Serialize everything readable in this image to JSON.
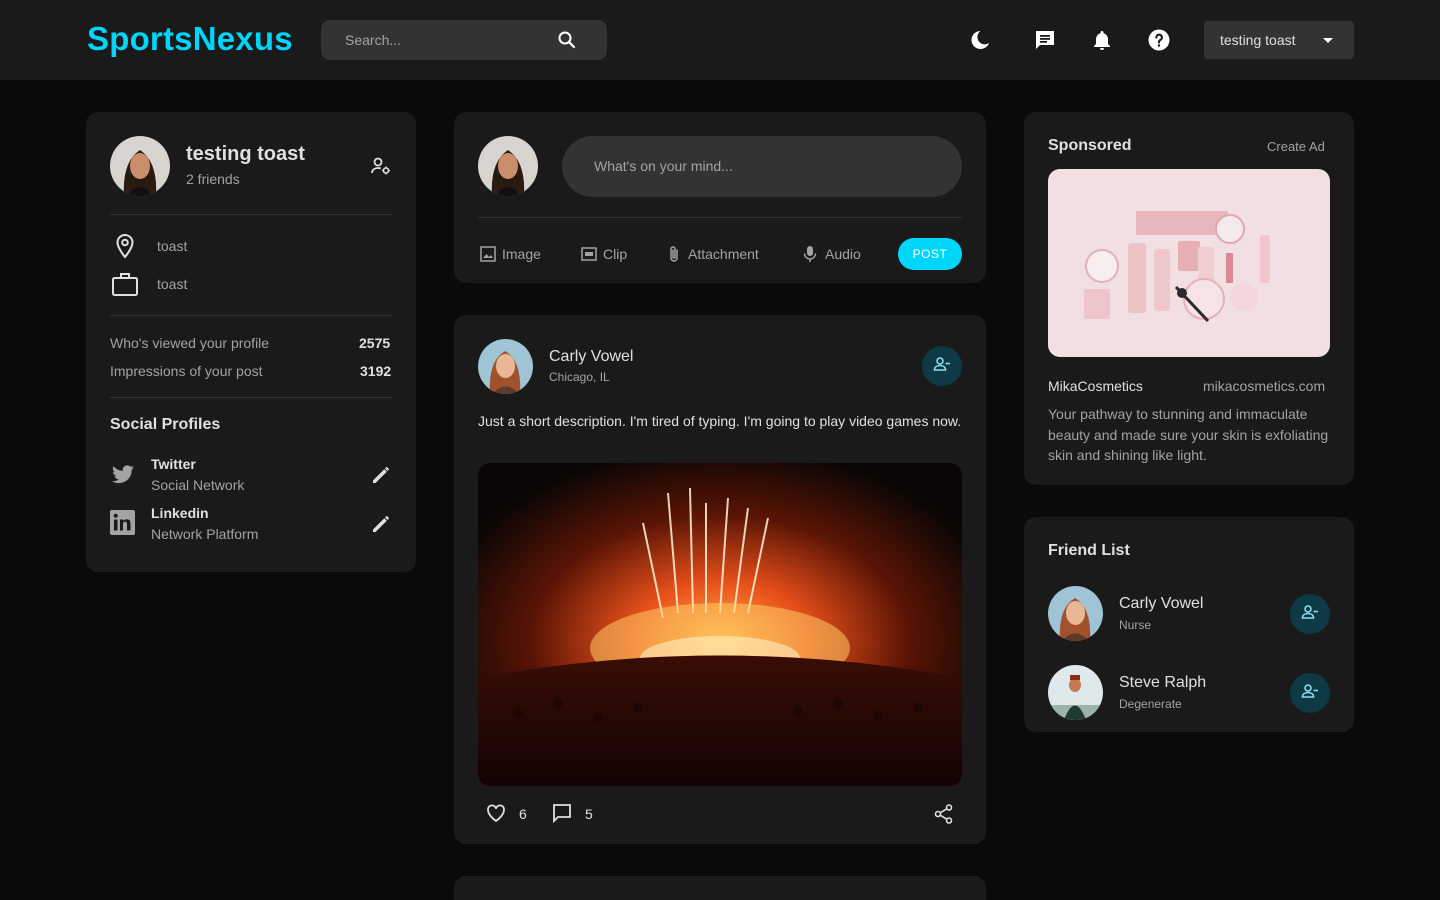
{
  "nav": {
    "logo": "SportsNexus",
    "search_placeholder": "Search...",
    "user_name": "testing toast"
  },
  "profile": {
    "name": "testing toast",
    "friends": "2 friends",
    "location": "toast",
    "occupation": "toast",
    "viewed_label": "Who's viewed your profile",
    "viewed_value": "2575",
    "impressions_label": "Impressions of your post",
    "impressions_value": "3192",
    "social_title": "Social Profiles",
    "socials": [
      {
        "name": "Twitter",
        "type": "Social Network"
      },
      {
        "name": "Linkedin",
        "type": "Network Platform"
      }
    ]
  },
  "composer": {
    "placeholder": "What's on your mind...",
    "actions": [
      "Image",
      "Clip",
      "Attachment",
      "Audio"
    ],
    "post_label": "POST"
  },
  "post": {
    "author": "Carly Vowel",
    "location": "Chicago, IL",
    "description": "Just a short description. I'm tired of typing. I'm going to play video games now.",
    "likes": "6",
    "comments": "5"
  },
  "sponsored": {
    "title": "Sponsored",
    "create_ad": "Create Ad",
    "brand": "MikaCosmetics",
    "url": "mikacosmetics.com",
    "description": "Your pathway to stunning and immaculate beauty and made sure your skin is exfoliating skin and shining like light."
  },
  "friends": {
    "title": "Friend List",
    "items": [
      {
        "name": "Carly Vowel",
        "role": "Nurse"
      },
      {
        "name": "Steve Ralph",
        "role": "Degenerate"
      }
    ]
  },
  "colors": {
    "accent": "#00d5fa",
    "background": "#0a0a0a",
    "card": "#1a1a1a",
    "input": "#333333"
  }
}
